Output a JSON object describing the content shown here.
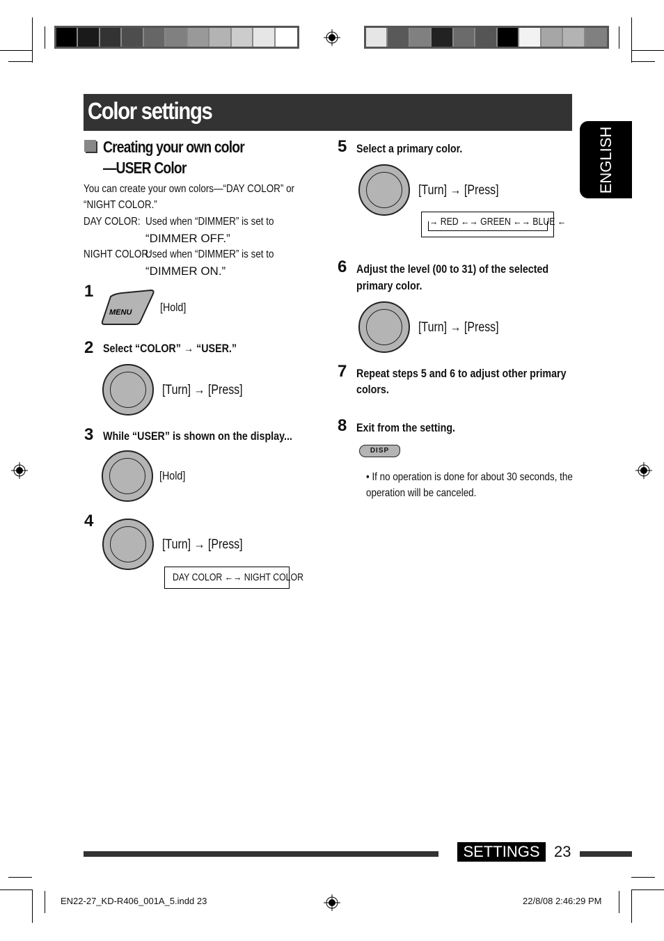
{
  "color_bars": {
    "left": [
      "#000000",
      "#1a1a1a",
      "#333333",
      "#4d4d4d",
      "#666666",
      "#808080",
      "#999999",
      "#b3b3b3",
      "#cccccc",
      "#e6e6e6",
      "#ffffff"
    ],
    "right": [
      "#e6e6e6",
      "#595959",
      "#808080",
      "#222222",
      "#6b6b6b",
      "#555555",
      "#000000",
      "#f2f2f2",
      "#a6a6a6",
      "#b3b3b3",
      "#808080"
    ]
  },
  "header": {
    "title": "Color settings"
  },
  "language_tab": "ENGLISH",
  "section": {
    "title_line1": "Creating your own color",
    "title_line2": "—USER Color",
    "intro_line1": "You can create your own colors—“DAY COLOR” or",
    "intro_line2": "“NIGHT COLOR.”",
    "day_label": "DAY COLOR:",
    "day_desc1": "Used when “DIMMER” is set to",
    "day_desc2": "“DIMMER OFF.”",
    "night_label": "NIGHT COLOR:",
    "night_desc1": "Used when “DIMMER” is set to",
    "night_desc2": "“DIMMER ON.”"
  },
  "steps": [
    {
      "num": "1",
      "button": "MENU",
      "action": "[Hold]"
    },
    {
      "num": "2",
      "text": "Select “COLOR” → “USER.”",
      "action": "[Turn] → [Press]"
    },
    {
      "num": "3",
      "text": "While “USER” is shown on the display...",
      "action": "[Hold]"
    },
    {
      "num": "4",
      "action": "[Turn] → [Press]",
      "display": "DAY COLOR ←→ NIGHT COLOR"
    },
    {
      "num": "5",
      "text": "Select a primary color.",
      "action": "[Turn] → [Press]",
      "display": "→ RED ←→ GREEN ←→ BLUE ←"
    },
    {
      "num": "6",
      "text_line1": "Adjust the level (00 to 31) of the selected",
      "text_line2": "primary color.",
      "action": "[Turn] → [Press]"
    },
    {
      "num": "7",
      "text_line1": "Repeat steps 5 and 6 to adjust other primary",
      "text_line2": "colors."
    },
    {
      "num": "8",
      "text": "Exit from the setting.",
      "button": "DISP",
      "note_line1": "•  If no operation is done for about 30 seconds, the",
      "note_line2": "operation will be canceled."
    }
  ],
  "footer": {
    "section_label": "SETTINGS",
    "page_number": "23",
    "slug_file": "EN22-27_KD-R406_001A_5.indd   23",
    "slug_date": "22/8/08   2:46:29 PM"
  }
}
